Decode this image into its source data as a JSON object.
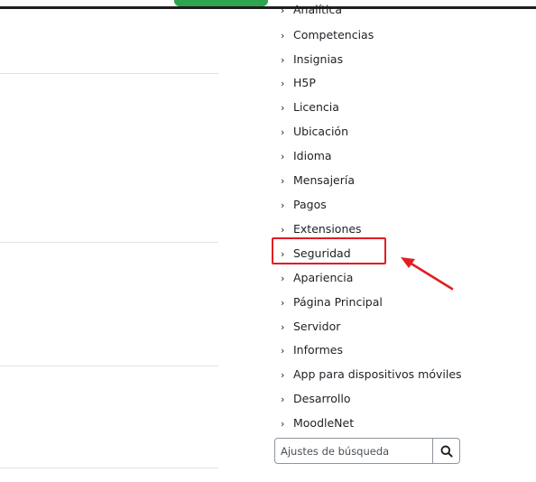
{
  "settings_tree": {
    "items": [
      {
        "label": "Analítica",
        "partial": true
      },
      {
        "label": "Competencias"
      },
      {
        "label": "Insignias"
      },
      {
        "label": "H5P"
      },
      {
        "label": "Licencia"
      },
      {
        "label": "Ubicación"
      },
      {
        "label": "Idioma"
      },
      {
        "label": "Mensajería"
      },
      {
        "label": "Pagos"
      },
      {
        "label": "Extensiones"
      },
      {
        "label": "Seguridad",
        "highlighted": true
      },
      {
        "label": "Apariencia"
      },
      {
        "label": "Página Principal"
      },
      {
        "label": "Servidor"
      },
      {
        "label": "Informes"
      },
      {
        "label": "App para dispositivos móviles"
      },
      {
        "label": "Desarrollo"
      },
      {
        "label": "MoodleNet"
      }
    ],
    "chevron": "›"
  },
  "search": {
    "placeholder": "Ajustes de búsqueda",
    "button_icon": "search-icon"
  },
  "annotation": {
    "highlight_color": "#e01e24",
    "arrow_color": "#e01e24"
  },
  "colors": {
    "top_button": "#2ea44f",
    "top_rule": "#1f1f1f",
    "divider": "#dee2e6",
    "text": "#1d2125"
  }
}
